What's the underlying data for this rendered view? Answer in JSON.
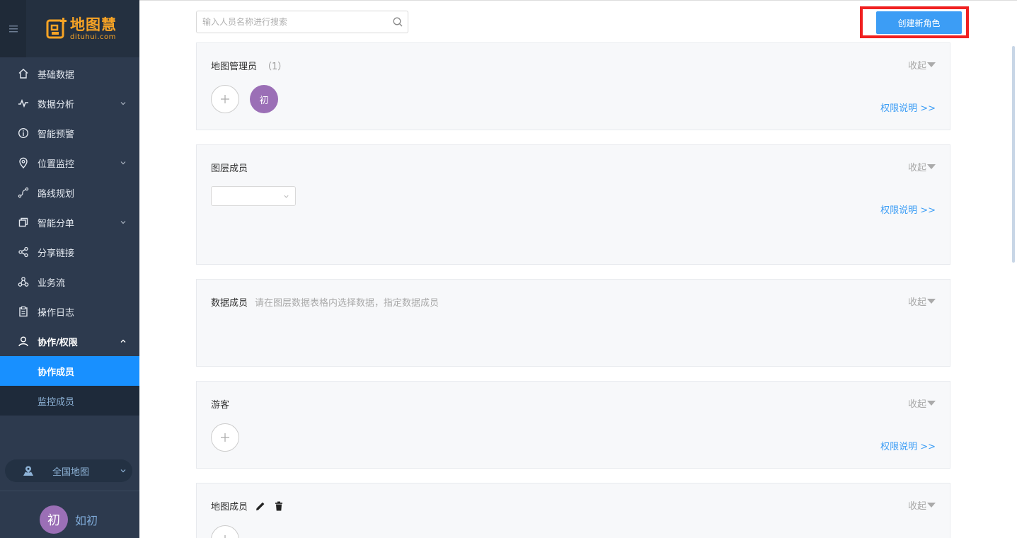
{
  "brand": {
    "name_cn": "地图慧",
    "name_en": "dituhui.com",
    "color": "#f7a325"
  },
  "sidebar": {
    "menu": [
      {
        "label": "基础数据",
        "icon": "home-icon",
        "expandable": false
      },
      {
        "label": "数据分析",
        "icon": "pulse-icon",
        "expandable": true
      },
      {
        "label": "智能预警",
        "icon": "info-icon",
        "expandable": false
      },
      {
        "label": "位置监控",
        "icon": "location-pin-icon",
        "expandable": true
      },
      {
        "label": "路线规划",
        "icon": "route-icon",
        "expandable": false
      },
      {
        "label": "智能分单",
        "icon": "copy-icon",
        "expandable": true
      },
      {
        "label": "分享链接",
        "icon": "share-icon",
        "expandable": false
      },
      {
        "label": "业务流",
        "icon": "flow-icon",
        "expandable": false
      },
      {
        "label": "操作日志",
        "icon": "clipboard-icon",
        "expandable": false
      },
      {
        "label": "协作/权限",
        "icon": "user-icon",
        "expandable": true,
        "expanded": true
      }
    ],
    "submenu": [
      {
        "label": "协作成员",
        "active": true
      },
      {
        "label": "监控成员",
        "active": false
      }
    ],
    "map_select": {
      "label": "全国地图"
    },
    "user": {
      "avatar_text": "初",
      "name": "如初"
    }
  },
  "toolbar": {
    "search_placeholder": "输入人员名称进行搜索",
    "create_button": "创建新角色"
  },
  "cards": {
    "map_admin": {
      "title": "地图管理员",
      "count": "（1）",
      "collapse": "收起",
      "member_avatar": "初",
      "perm_link": "权限说明 >>"
    },
    "layer_members": {
      "title": "图层成员",
      "collapse": "收起",
      "perm_link": "权限说明 >>"
    },
    "data_members": {
      "title": "数据成员",
      "hint": "请在图层数据表格内选择数据，指定数据成员",
      "collapse": "收起"
    },
    "guests": {
      "title": "游客",
      "collapse": "收起",
      "perm_link": "权限说明 >>"
    },
    "map_members": {
      "title": "地图成员",
      "collapse": "收起"
    }
  },
  "colors": {
    "sidebar_bg": "#2d3a4e",
    "active": "#1890ff",
    "accent": "#3c9df5",
    "highlight_border": "#f02020",
    "avatar": "#9b6fb6"
  }
}
